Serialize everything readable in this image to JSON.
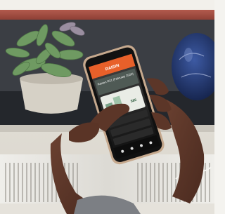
{
  "scene": {
    "description_free": true
  },
  "phone": {
    "app_name": "RAISIN",
    "banner_text": "Raisen R21 (February 2020)",
    "stat_value": "$85",
    "nav_items": [
      "",
      "",
      "",
      ""
    ]
  },
  "colors": {
    "app_header": "#e8602a",
    "vase_blue": "#253a72",
    "plant_green": "#6f9a62"
  }
}
